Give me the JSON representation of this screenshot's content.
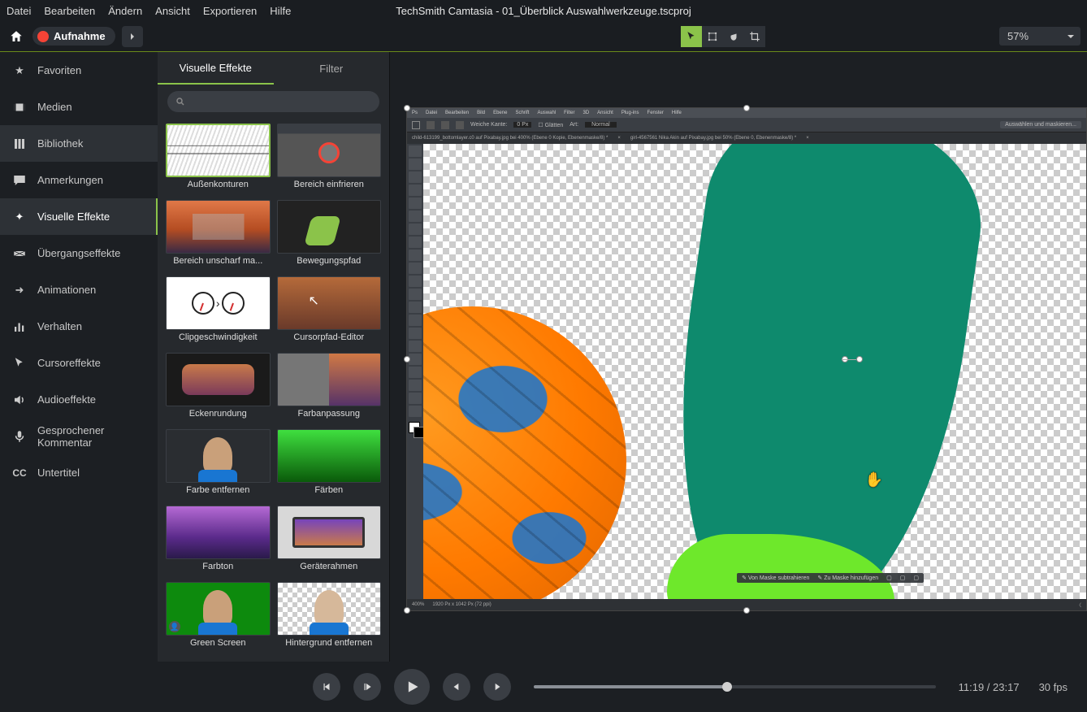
{
  "window_title": "TechSmith Camtasia - 01_Überblick Auswahlwerkzeuge.tscproj",
  "menu": [
    "Datei",
    "Bearbeiten",
    "Ändern",
    "Ansicht",
    "Exportieren",
    "Hilfe"
  ],
  "record_label": "Aufnahme",
  "zoom_value": "57%",
  "sidebar": [
    {
      "label": "Favoriten"
    },
    {
      "label": "Medien"
    },
    {
      "label": "Bibliothek"
    },
    {
      "label": "Anmerkungen"
    },
    {
      "label": "Visuelle Effekte",
      "active": true
    },
    {
      "label": "Übergangseffekte"
    },
    {
      "label": "Animationen"
    },
    {
      "label": "Verhalten"
    },
    {
      "label": "Cursoreffekte"
    },
    {
      "label": "Audioeffekte"
    },
    {
      "label": "Gesprochener Kommentar"
    },
    {
      "label": "Untertitel"
    }
  ],
  "tabs": {
    "visual": "Visuelle Effekte",
    "filter": "Filter"
  },
  "search_placeholder": "",
  "effects": [
    {
      "label": "Außenkonturen",
      "selected": true
    },
    {
      "label": "Bereich einfrieren"
    },
    {
      "label": "Bereich unscharf ma..."
    },
    {
      "label": "Bewegungspfad"
    },
    {
      "label": "Clipgeschwindigkeit"
    },
    {
      "label": "Cursorpfad-Editor"
    },
    {
      "label": "Eckenrundung"
    },
    {
      "label": "Farbanpassung"
    },
    {
      "label": "Farbe entfernen"
    },
    {
      "label": "Färben"
    },
    {
      "label": "Farbton"
    },
    {
      "label": "Geräterahmen"
    },
    {
      "label": "Green Screen"
    },
    {
      "label": "Hintergrund entfernen"
    }
  ],
  "ps_menu": [
    "Ps",
    "Datei",
    "Bearbeiten",
    "Bild",
    "Ebene",
    "Schrift",
    "Auswahl",
    "Filter",
    "3D",
    "Ansicht",
    "Plug-ins",
    "Fenster",
    "Hilfe"
  ],
  "ps_opt": {
    "kante": "Weiche Kante:",
    "kante_val": "0 Px",
    "glatten": "Glätten",
    "art": "Art:",
    "normal": "Normal",
    "btn": "Auswählen und maskieren..."
  },
  "ps_tabs": [
    "child-613199_bottomlayer.c0 auf Pixabay.jpg bei 400% (Ebene 0 Kopie, Ebenenmaske/8) *",
    "girl-4567561 Nika Akin auf Pixabay.jpg bei 50% (Ebene 0, Ebenenmaske/8) *"
  ],
  "ps_status": {
    "zoom": "400%",
    "dims": "1920 Px x 1042 Px (72 ppi)"
  },
  "ps_float": {
    "sub": "Von Maske subtrahieren",
    "add": "Zu Maske hinzufügen"
  },
  "playback": {
    "time_current": "11:19",
    "time_total": "23:17",
    "fps": "30 fps"
  }
}
